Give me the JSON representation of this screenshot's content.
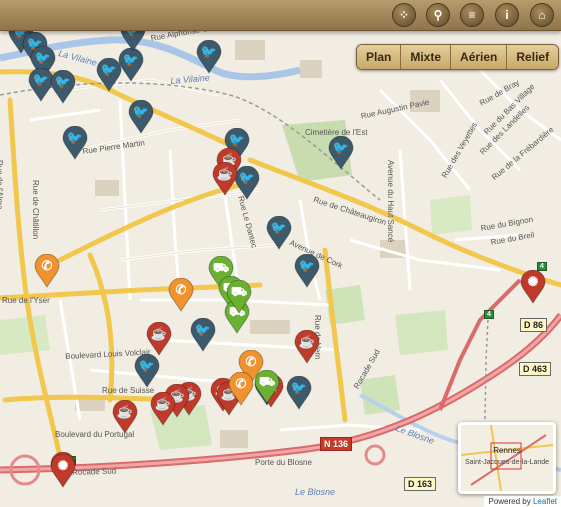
{
  "toolbar": {
    "buttons": [
      {
        "icon": "grid-icon",
        "glyph": "⁘"
      },
      {
        "icon": "search-icon",
        "glyph": "⚲"
      },
      {
        "icon": "menu-icon",
        "glyph": "≡"
      },
      {
        "icon": "info-icon",
        "glyph": "i"
      },
      {
        "icon": "home-icon",
        "glyph": "⌂"
      }
    ]
  },
  "layers": [
    "Plan",
    "Mixte",
    "Aérien",
    "Relief"
  ],
  "streets": [
    "Rue Alphonse Guérin",
    "La Vilaine",
    "La Vilaine",
    "Rue Pierre Martin",
    "Rue de l'Alma",
    "Rue de Châtillon",
    "Cimetière de l'Est",
    "Rue Augustin Pavie",
    "Rue de Châteaugiron",
    "Rue Le Dantec",
    "Avenue de Cork",
    "Avenue du Haut Sancé",
    "Rue de Bray",
    "Rue du Bas Village",
    "Rue des Landelles",
    "Rue de la Frébardière",
    "Rue des Veyettes",
    "Rue du Bignon",
    "Rue du Breil",
    "Rue de l'Yser",
    "Boulevard Louis Volclair",
    "Rue de Vern",
    "Rue de Suisse",
    "Boulevard du Portugal",
    "Rocade Sud",
    "Rocade Sud",
    "Porte du Blosne",
    "Le Blosne",
    "Le Blosne"
  ],
  "road_shields": [
    {
      "text": "D 86",
      "style": "plain"
    },
    {
      "text": "D 463",
      "style": "plain"
    },
    {
      "text": "N 136",
      "style": "red"
    },
    {
      "text": "D 163",
      "style": "plain"
    },
    {
      "text": "4",
      "style": "green"
    },
    {
      "text": "4",
      "style": "green"
    },
    {
      "text": "4b",
      "style": "green"
    }
  ],
  "markers": {
    "colors": {
      "twitter": "#3d5a6c",
      "cafe": "#c03a2b",
      "phone": "#f0922e",
      "truck": "#6ab033",
      "alert": "#c03a2b"
    },
    "icons": {
      "twitter": "bird-icon",
      "cafe": "coffee-cup-icon",
      "phone": "phone-icon",
      "truck": "delivery-truck-icon",
      "alert": "alert-icon"
    },
    "glyphs": {
      "twitter": "🐦",
      "cafe": "☕",
      "phone": "✆",
      "truck": "⛟",
      "alert": "✺"
    },
    "counts": {
      "twitter": 20,
      "cafe": 12,
      "phone": 4,
      "truck": 5,
      "alert": 2
    }
  },
  "minimap": {
    "title": "Rennes",
    "subtitle": "Saint-Jacques-de-la-Lande"
  },
  "attribution": {
    "prefix": "Powered by",
    "link": "Leaflet"
  }
}
